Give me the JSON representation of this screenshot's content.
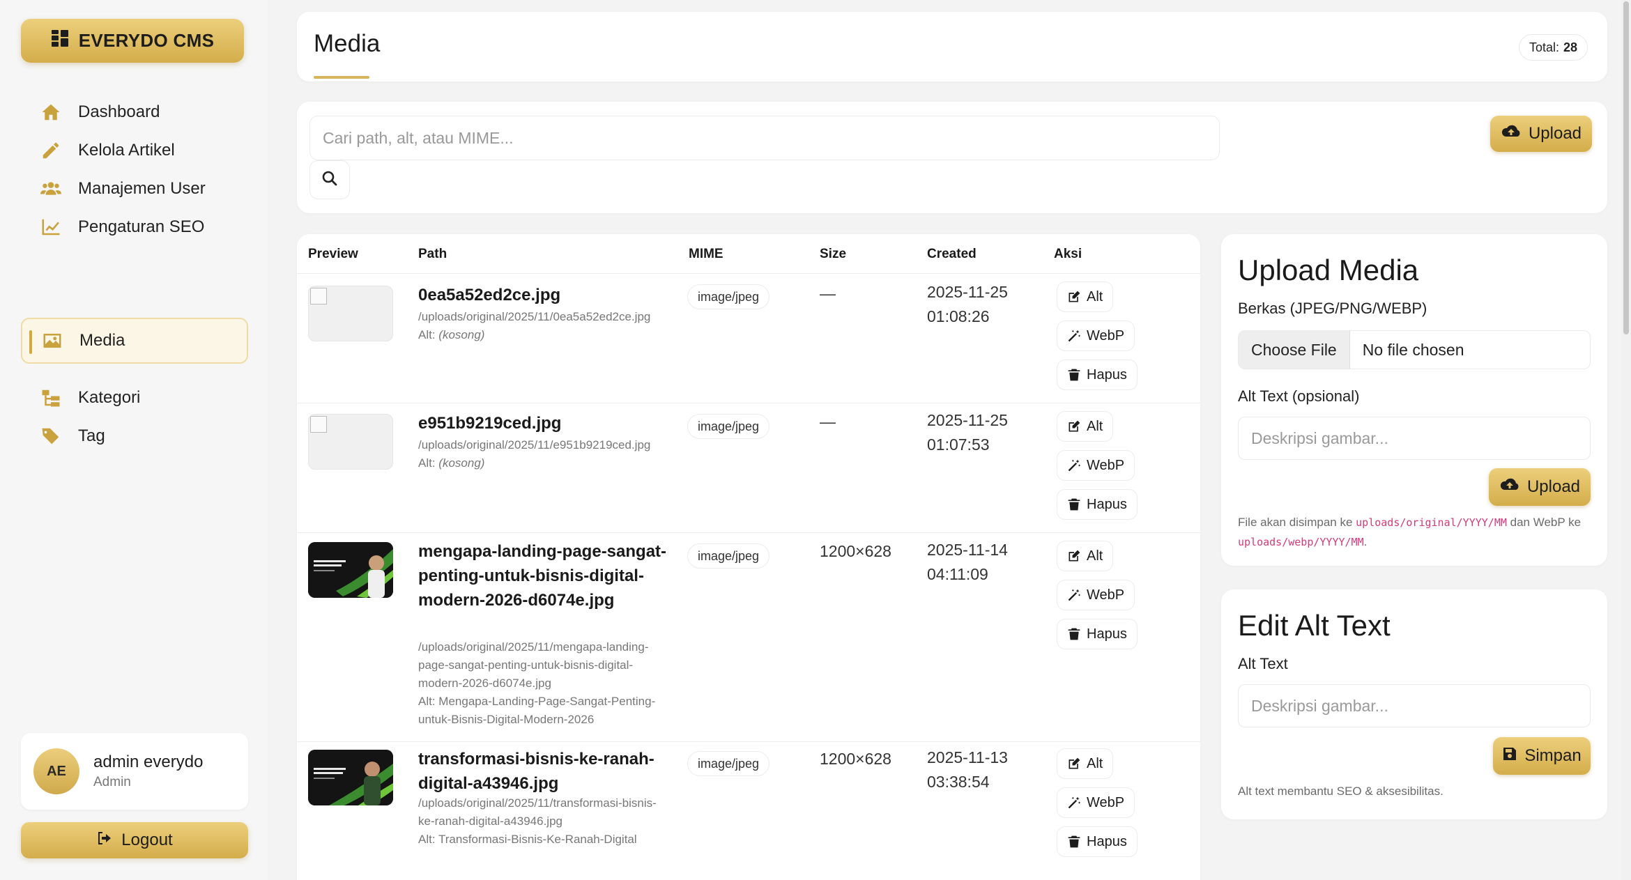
{
  "brand": {
    "label": "EVERYDO CMS",
    "icon": "grid-icon"
  },
  "nav": [
    {
      "label": "Dashboard",
      "icon": "home-icon",
      "active": false
    },
    {
      "label": "Kelola Artikel",
      "icon": "pencil-icon",
      "active": false
    },
    {
      "label": "Manajemen User",
      "icon": "users-icon",
      "active": false
    },
    {
      "label": "Pengaturan SEO",
      "icon": "chart-line-icon",
      "active": false
    },
    {
      "label": "Media",
      "icon": "image-icon",
      "active": true
    },
    {
      "label": "Kategori",
      "icon": "sitemap-icon",
      "active": false
    },
    {
      "label": "Tag",
      "icon": "tags-icon",
      "active": false
    }
  ],
  "user": {
    "initials": "AE",
    "name": "admin everydo",
    "role": "Admin"
  },
  "logout_label": "Logout",
  "header": {
    "title": "Media",
    "total_label": "Total:",
    "total_value": "28"
  },
  "search": {
    "placeholder": "Cari path, alt, atau MIME...",
    "upload_label": "Upload"
  },
  "table": {
    "columns": [
      "Preview",
      "Path",
      "MIME",
      "Size",
      "Created",
      "Aksi"
    ],
    "actions": {
      "alt": "Alt",
      "webp": "WebP",
      "delete": "Hapus"
    },
    "rows": [
      {
        "name": "0ea5a52ed2ce.jpg",
        "path": "/uploads/original/2025/11/0ea5a52ed2ce.jpg",
        "alt_prefix": "Alt:",
        "alt": "(kosong)",
        "mime": "image/jpeg",
        "size": "—",
        "created_date": "2025-11-25",
        "created_time": "01:08:26",
        "has_thumb": false
      },
      {
        "name": "e951b9219ced.jpg",
        "path": "/uploads/original/2025/11/e951b9219ced.jpg",
        "alt_prefix": "Alt:",
        "alt": "(kosong)",
        "mime": "image/jpeg",
        "size": "—",
        "created_date": "2025-11-25",
        "created_time": "01:07:53",
        "has_thumb": false
      },
      {
        "name": "mengapa-landing-page-sangat-penting-untuk-bisnis-digital-modern-2026-d6074e.jpg",
        "path": "/uploads/original/2025/11/mengapa-landing-page-sangat-penting-untuk-bisnis-digital-modern-2026-d6074e.jpg",
        "alt_prefix": "Alt:",
        "alt": "Mengapa-Landing-Page-Sangat-Penting-untuk-Bisnis-Digital-Modern-2026",
        "mime": "image/jpeg",
        "size": "1200×628",
        "created_date": "2025-11-14",
        "created_time": "04:11:09",
        "has_thumb": true,
        "thumb_text": "MENGAPA LANDING PAGE SANGAT PENTING"
      },
      {
        "name": "transformasi-bisnis-ke-ranah-digital-a43946.jpg",
        "path": "/uploads/original/2025/11/transformasi-bisnis-ke-ranah-digital-a43946.jpg",
        "alt_prefix": "Alt:",
        "alt": "Transformasi-Bisnis-Ke-Ranah-Digital",
        "mime": "image/jpeg",
        "size": "1200×628",
        "created_date": "2025-11-13",
        "created_time": "03:38:54",
        "has_thumb": true,
        "thumb_text": "TRANSFORMASI BISNIS KE RANAH DIGITAL"
      }
    ]
  },
  "upload_panel": {
    "title": "Upload Media",
    "file_label": "Berkas (JPEG/PNG/WEBP)",
    "choose_label": "Choose File",
    "no_file": "No file chosen",
    "alt_label": "Alt Text (opsional)",
    "alt_placeholder": "Deskripsi gambar...",
    "button": "Upload",
    "note_a": "File akan disimpan ke",
    "note_path1": "uploads/original/YYYY/MM",
    "note_b": "dan WebP ke",
    "note_path2": "uploads/webp/YYYY/MM",
    "note_c": "."
  },
  "edit_panel": {
    "title": "Edit Alt Text",
    "alt_label": "Alt Text",
    "alt_placeholder": "Deskripsi gambar...",
    "button": "Simpan",
    "note": "Alt text membantu SEO & aksesibilitas."
  },
  "colors": {
    "accent": "#d4ad4a",
    "accent_light": "#eccf7c",
    "code": "#d13b7c"
  }
}
